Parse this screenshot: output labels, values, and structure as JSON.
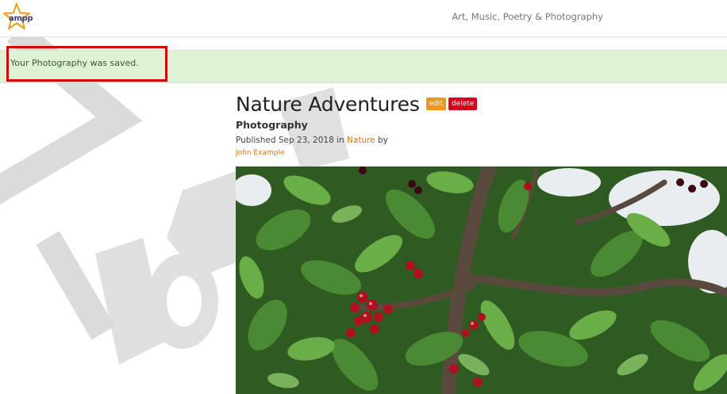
{
  "header": {
    "logo_text": "ampp",
    "tagline": "Art, Music, Poetry & Photography"
  },
  "alert": {
    "message": "Your Photography was saved."
  },
  "post": {
    "title": "Nature Adventures",
    "edit_label": "edit",
    "delete_label": "delete",
    "category": "Photography",
    "published_prefix": "Published Sep 23, 2018 in ",
    "published_category": "Nature",
    "published_suffix": " by",
    "author": "John Example"
  },
  "photo": {
    "subject": "cherry tree branches with red cherries and green leaves"
  },
  "colors": {
    "accent_orange": "#f0961e",
    "delete_red": "#d9001b",
    "alert_bg": "#dff2d4",
    "highlight_red": "#d40000",
    "link_orange": "#e07a1c"
  }
}
